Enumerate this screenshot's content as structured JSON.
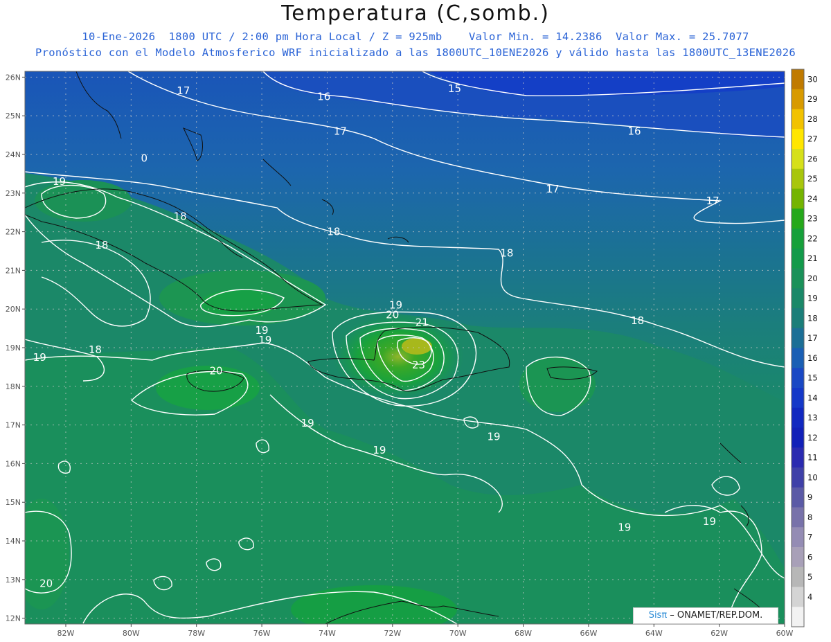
{
  "header": {
    "title": "Temperatura (C,somb.)",
    "date": "10-Ene-2026",
    "time": "1800 UTC / 2:00 pm Hora Local / Z = 925mb",
    "min_label": "Valor Min. = 14.2386",
    "max_label": "Valor Max. = 25.7077",
    "forecast_line": "Pronóstico con el Modelo Atmosferico WRF inicializado a las 1800UTC_10ENE2026 y válido hasta las  1800UTC_13ENE2026"
  },
  "map": {
    "lat_labels": [
      "26N",
      "25N",
      "24N",
      "23N",
      "22N",
      "21N",
      "20N",
      "19N",
      "18N",
      "17N",
      "16N",
      "15N",
      "14N",
      "13N",
      "12N"
    ],
    "lon_labels": [
      "82W",
      "80W",
      "78W",
      "76W",
      "74W",
      "72W",
      "70W",
      "68W",
      "66W",
      "64W",
      "62W",
      "60W"
    ],
    "contour_labels": [
      {
        "text": "17",
        "lon": -78.4,
        "lat": 25.65
      },
      {
        "text": "16",
        "lon": -74.1,
        "lat": 25.5
      },
      {
        "text": "15",
        "lon": -70.1,
        "lat": 25.7
      },
      {
        "text": "17",
        "lon": -73.6,
        "lat": 24.6
      },
      {
        "text": "16",
        "lon": -64.6,
        "lat": 24.6
      },
      {
        "text": "0",
        "lon": -79.6,
        "lat": 23.9
      },
      {
        "text": "19",
        "lon": -82.2,
        "lat": 23.3
      },
      {
        "text": "17",
        "lon": -67.1,
        "lat": 23.1
      },
      {
        "text": "17",
        "lon": -62.2,
        "lat": 22.8
      },
      {
        "text": "18",
        "lon": -78.5,
        "lat": 22.4
      },
      {
        "text": "18",
        "lon": -73.8,
        "lat": 22.0
      },
      {
        "text": "18",
        "lon": -80.9,
        "lat": 21.65
      },
      {
        "text": "18",
        "lon": -68.5,
        "lat": 21.45
      },
      {
        "text": "19",
        "lon": -71.9,
        "lat": 20.1
      },
      {
        "text": "20",
        "lon": -72.0,
        "lat": 19.85
      },
      {
        "text": "21",
        "lon": -71.1,
        "lat": 19.65
      },
      {
        "text": "18",
        "lon": -64.5,
        "lat": 19.7
      },
      {
        "text": "19",
        "lon": -76.0,
        "lat": 19.45
      },
      {
        "text": "19",
        "lon": -75.9,
        "lat": 19.2
      },
      {
        "text": "18",
        "lon": -81.1,
        "lat": 18.95
      },
      {
        "text": "19",
        "lon": -82.8,
        "lat": 18.75
      },
      {
        "text": "23",
        "lon": -71.2,
        "lat": 18.55
      },
      {
        "text": "20",
        "lon": -77.4,
        "lat": 18.4
      },
      {
        "text": "19",
        "lon": -74.6,
        "lat": 17.05
      },
      {
        "text": "19",
        "lon": -68.9,
        "lat": 16.7
      },
      {
        "text": "19",
        "lon": -72.4,
        "lat": 16.35
      },
      {
        "text": "19",
        "lon": -64.9,
        "lat": 14.35
      },
      {
        "text": "19",
        "lon": -62.3,
        "lat": 14.5
      },
      {
        "text": "20",
        "lon": -82.6,
        "lat": 12.9
      }
    ]
  },
  "colorbar": {
    "ticks": [
      "30",
      "29",
      "28",
      "27",
      "26",
      "25",
      "24",
      "23",
      "22",
      "21",
      "20",
      "19",
      "18",
      "17",
      "16",
      "15",
      "14",
      "13",
      "12",
      "11",
      "10",
      "9",
      "8",
      "7",
      "6",
      "5",
      "4"
    ],
    "colors": [
      "#c07a00",
      "#d89a00",
      "#f2c200",
      "#ffe600",
      "#d6e01a",
      "#a8c60c",
      "#74b400",
      "#25a81b",
      "#16a03a",
      "#129a4a",
      "#1a9159",
      "#1a8868",
      "#1b7e79",
      "#1c6f96",
      "#1a5fb4",
      "#1a48c4",
      "#1538c8",
      "#1128c0",
      "#1120b8",
      "#2a2ab0",
      "#3f40a8",
      "#5b5aa6",
      "#7872aa",
      "#948cb4",
      "#a8a0b8",
      "#b7b7b7",
      "#d4d4d4",
      "#f2f2f2"
    ]
  },
  "credit": {
    "brand": "Sisπ",
    "text": " – ONAMET/REP.DOM."
  }
}
